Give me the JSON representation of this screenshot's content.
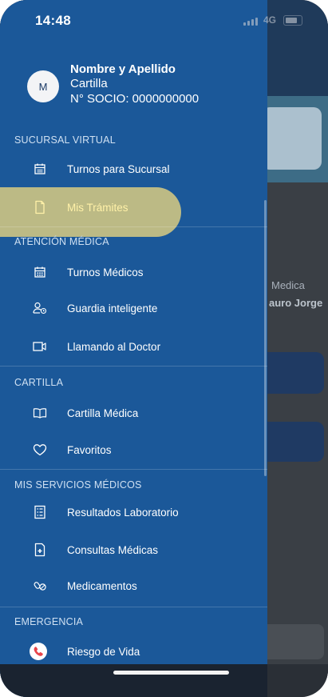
{
  "status_bar": {
    "time": "14:48",
    "network": "4G"
  },
  "profile": {
    "avatar_initial": "M",
    "name": "Nombre y Apellido",
    "plan": "Cartilla",
    "member": "N° SOCIO: 0000000000"
  },
  "drawer": {
    "sections": [
      {
        "title": "SUCURSAL VIRTUAL",
        "items": [
          {
            "label": "Turnos para Sucursal",
            "icon": "calendar-icon"
          },
          {
            "label": "Mis Trámites",
            "icon": "document-icon",
            "active": true
          }
        ]
      },
      {
        "title": "ATENCIÓN MÉDICA",
        "items": [
          {
            "label": "Turnos Médicos",
            "icon": "calendar-grid-icon"
          },
          {
            "label": "Guardia inteligente",
            "icon": "user-clock-icon"
          },
          {
            "label": "Llamando al Doctor",
            "icon": "video-call-icon"
          }
        ]
      },
      {
        "title": "CARTILLA",
        "items": [
          {
            "label": "Cartilla Médica",
            "icon": "book-icon"
          },
          {
            "label": "Favoritos",
            "icon": "heart-icon"
          }
        ]
      },
      {
        "title": "MIS SERVICIOS MÉDICOS",
        "items": [
          {
            "label": "Resultados Laboratorio",
            "icon": "lab-list-icon"
          },
          {
            "label": "Consultas Médicas",
            "icon": "medical-doc-icon"
          },
          {
            "label": "Medicamentos",
            "icon": "pills-icon"
          }
        ]
      },
      {
        "title": "EMERGENCIA",
        "items": [
          {
            "label": "Riesgo de Vida",
            "icon": "phone-emergency-icon"
          }
        ]
      }
    ]
  },
  "background": {
    "label": "Medica",
    "name": "auro Jorge"
  },
  "colors": {
    "drawer": "#1b5899",
    "highlight": "#c8c283",
    "emergency": "#e8454b"
  }
}
